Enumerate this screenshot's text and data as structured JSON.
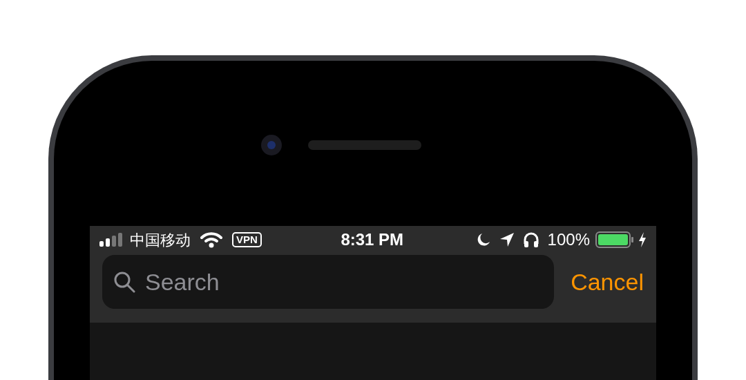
{
  "status_bar": {
    "carrier": "中国移动",
    "vpn": "VPN",
    "time": "8:31 PM",
    "battery": "100%"
  },
  "search": {
    "placeholder": "Search",
    "cancel": "Cancel"
  }
}
